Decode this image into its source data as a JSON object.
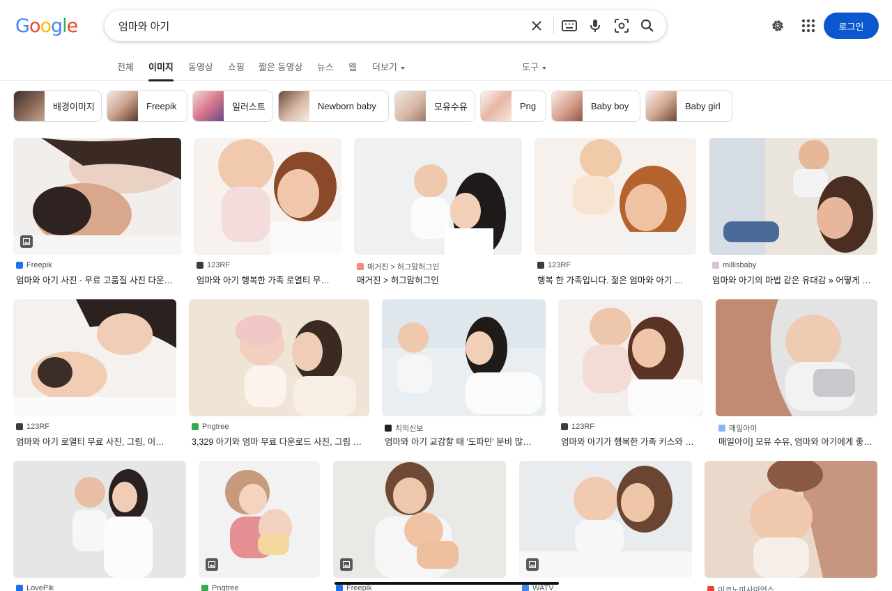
{
  "header": {
    "logo_letters": [
      "G",
      "o",
      "o",
      "g",
      "l",
      "e"
    ],
    "query": "엄마와 아기",
    "login_label": "로그인"
  },
  "tabs": [
    {
      "label": "전체"
    },
    {
      "label": "이미지"
    },
    {
      "label": "동영상"
    },
    {
      "label": "쇼핑"
    },
    {
      "label": "짧은 동영상"
    },
    {
      "label": "뉴스"
    },
    {
      "label": "웹"
    },
    {
      "label": "더보기"
    }
  ],
  "tools_label": "도구",
  "chips": [
    {
      "label": "배경이미지"
    },
    {
      "label": "Freepik"
    },
    {
      "label": "일러스트"
    },
    {
      "label": "Newborn baby"
    },
    {
      "label": "모유수유"
    },
    {
      "label": "Png"
    },
    {
      "label": "Baby boy"
    },
    {
      "label": "Baby girl"
    }
  ],
  "results": [
    {
      "source": "Freepik",
      "title": "엄마와 아기 사진 - 무료 고품질 사진 다운…",
      "fav": "#1a73e8"
    },
    {
      "source": "123RF",
      "title": "엄마와 아기 행복한 가족 로열티 무…",
      "fav": "#3c3c3c"
    },
    {
      "source": "매거진 > 허그맘허그인",
      "title": "매거진 > 허그맘허그인",
      "fav": "#f28b82"
    },
    {
      "source": "123RF",
      "title": "행복 한 가족입니다. 젊은 엄마와 아기 …",
      "fav": "#3c3c3c"
    },
    {
      "source": "millisbaby",
      "title": "엄마와 아기의 마법 같은 유대감 » 어떻게 …",
      "fav": "#d7c1d6"
    },
    {
      "source": "123RF",
      "title": "엄마와 아기 로열티 무료 사진, 그림, 이…",
      "fav": "#3c3c3c"
    },
    {
      "source": "Pngtree",
      "title": "3,329 아기와 엄마 무료 다운로드 사진, 그림 …",
      "fav": "#34a853"
    },
    {
      "source": "치의신보",
      "title": "엄마와 아기 교감할 때 '도파민' 분비 많…",
      "fav": "#202124"
    },
    {
      "source": "123RF",
      "title": "엄마와 아기가 행복한 가족 키스와 …",
      "fav": "#3c3c3c"
    },
    {
      "source": "매일아이",
      "title": "매일아이] 모유 수유, 엄마와 아기에게 좋…",
      "fav": "#8ab4f8"
    },
    {
      "source": "LovePik",
      "title": "",
      "fav": "#1a73e8"
    },
    {
      "source": "Pngtree",
      "title": "",
      "fav": "#34a853"
    },
    {
      "source": "Freepik",
      "title": "",
      "fav": "#1a73e8"
    },
    {
      "source": "WATV",
      "title": "",
      "fav": "#4285f4"
    },
    {
      "source": "이코노미사이언스",
      "title": "",
      "fav": "#ea4335"
    }
  ]
}
